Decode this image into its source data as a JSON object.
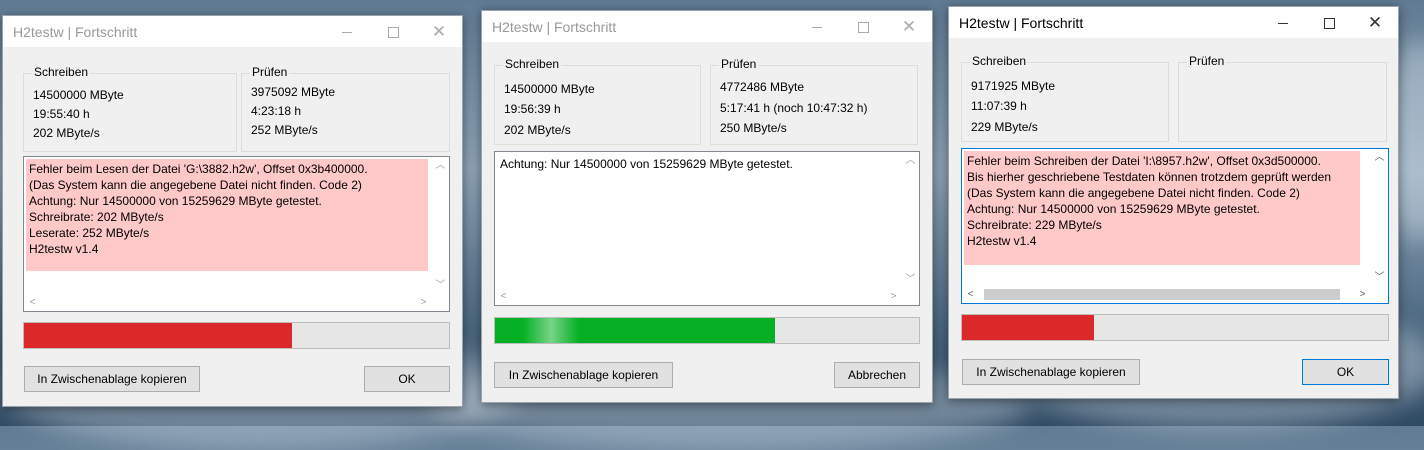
{
  "colors": {
    "error_bg": "#ffc9c9",
    "progress_red": "#dc2828",
    "progress_green": "#06b025",
    "progress_track": "#e6e6e6"
  },
  "windows": [
    {
      "title": "H2testw | Fortschritt",
      "active": false,
      "write": {
        "label": "Schreiben",
        "size": "14500000 MByte",
        "time": "19:55:40 h",
        "rate": "202 MByte/s"
      },
      "verify": {
        "label": "Prüfen",
        "size": "3975092 MByte",
        "time": "4:23:18 h",
        "rate": "252 MByte/s"
      },
      "log": "Fehler beim Lesen der Datei 'G:\\3882.h2w', Offset 0x3b400000.\n(Das System kann die angegebene Datei nicht finden. Code 2)\nAchtung: Nur 14500000 von 15259629 MByte getestet.\nSchreibrate: 202 MByte/s\nLeserate: 252 MByte/s\nH2testw v1.4",
      "log_error": true,
      "progress_percent": 63,
      "progress_color": "#dc2828",
      "copy_button": "In Zwischenablage kopieren",
      "right_button": "OK"
    },
    {
      "title": "H2testw | Fortschritt",
      "active": false,
      "write": {
        "label": "Schreiben",
        "size": "14500000 MByte",
        "time": "19:56:39 h",
        "rate": "202 MByte/s"
      },
      "verify": {
        "label": "Prüfen",
        "size": "4772486 MByte",
        "time": "5:17:41 h (noch 10:47:32 h)",
        "rate": "250 MByte/s"
      },
      "log": "Achtung: Nur 14500000 von 15259629 MByte getestet.",
      "log_error": false,
      "progress_percent": 66,
      "progress_color": "#06b025",
      "copy_button": "In Zwischenablage kopieren",
      "right_button": "Abbrechen"
    },
    {
      "title": "H2testw | Fortschritt",
      "active": true,
      "write": {
        "label": "Schreiben",
        "size": "9171925 MByte",
        "time": "11:07:39 h",
        "rate": "229 MByte/s"
      },
      "verify": {
        "label": "Prüfen",
        "size": "",
        "time": "",
        "rate": ""
      },
      "log": "Fehler beim Schreiben der Datei 'I:\\8957.h2w', Offset 0x3d500000.\nBis hierher geschriebene Testdaten können trotzdem geprüft werden\n(Das System kann die angegebene Datei nicht finden. Code 2)\nAchtung: Nur 14500000 von 15259629 MByte getestet.\nSchreibrate: 229 MByte/s\nH2testw v1.4",
      "log_error": true,
      "progress_percent": 31,
      "progress_color": "#dc2828",
      "copy_button": "In Zwischenablage kopieren",
      "right_button": "OK"
    }
  ],
  "icons": [
    "minimize-icon",
    "maximize-icon",
    "close-icon",
    "scroll-up-icon",
    "scroll-down-icon",
    "scroll-left-icon",
    "scroll-right-icon"
  ]
}
